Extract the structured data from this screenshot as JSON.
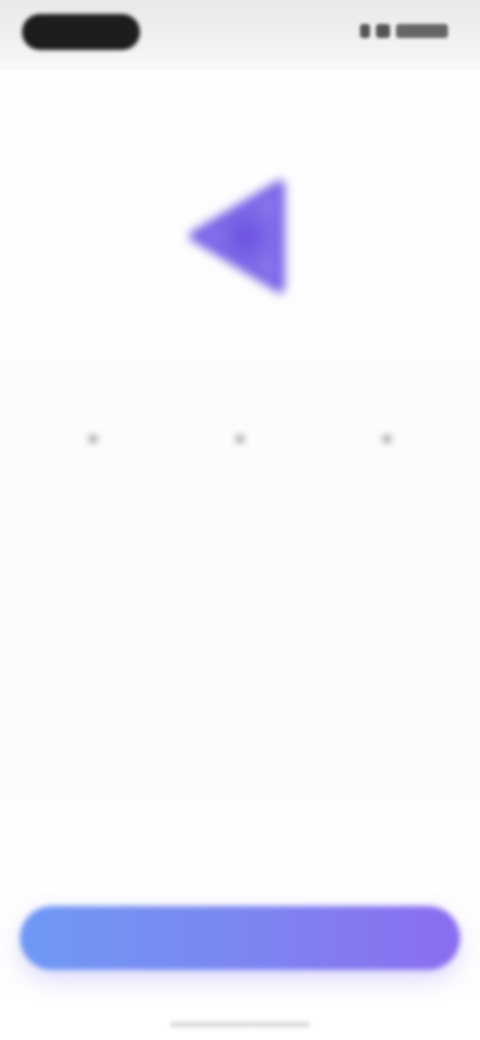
{
  "status_bar": {
    "time": "",
    "icons": [
      "signal-icon",
      "wifi-icon",
      "battery-icon"
    ]
  },
  "nav": {
    "back_label": ""
  },
  "hero": {
    "logo_icon": "play-triangle-icon",
    "logo_color": "#7a63e6",
    "title": "",
    "features": [
      "",
      "",
      "",
      ""
    ],
    "feature_tail": "",
    "description": "",
    "note": ""
  },
  "cta": {
    "label": "",
    "gradient_start": "#6f98f5",
    "gradient_end": "#8c6cf0"
  }
}
